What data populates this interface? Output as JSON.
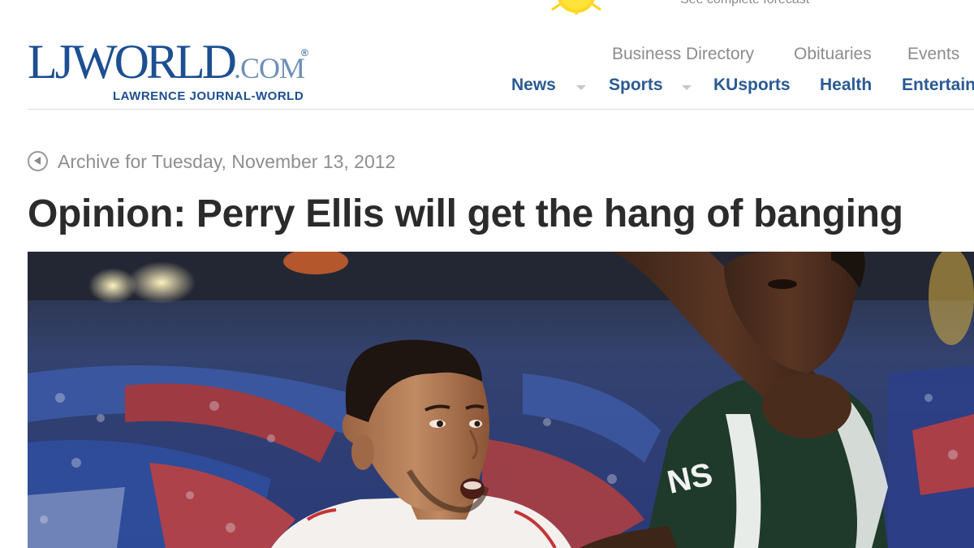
{
  "forecast": {
    "text": "See complete forecast"
  },
  "logo": {
    "primary": "LJ",
    "world": "WORLD",
    "com": ".COM",
    "registered": "®",
    "tagline": "LAWRENCE JOURNAL-WORLD"
  },
  "secondary_nav": {
    "items": [
      "Business Directory",
      "Obituaries",
      "Events"
    ]
  },
  "main_nav": {
    "items": [
      "News",
      "Sports",
      "KUsports",
      "Health",
      "Entertain"
    ]
  },
  "archive": {
    "text": "Archive for Tuesday, November 13, 2012"
  },
  "article": {
    "headline": "Opinion: Perry Ellis will get the hang of banging"
  },
  "photo": {
    "jersey_text": "NS"
  },
  "colors": {
    "brand_blue": "#1d4f91",
    "nav_blue": "#2a5a93",
    "muted_gray": "#8c8c8c",
    "headline": "#2b2b2b"
  }
}
